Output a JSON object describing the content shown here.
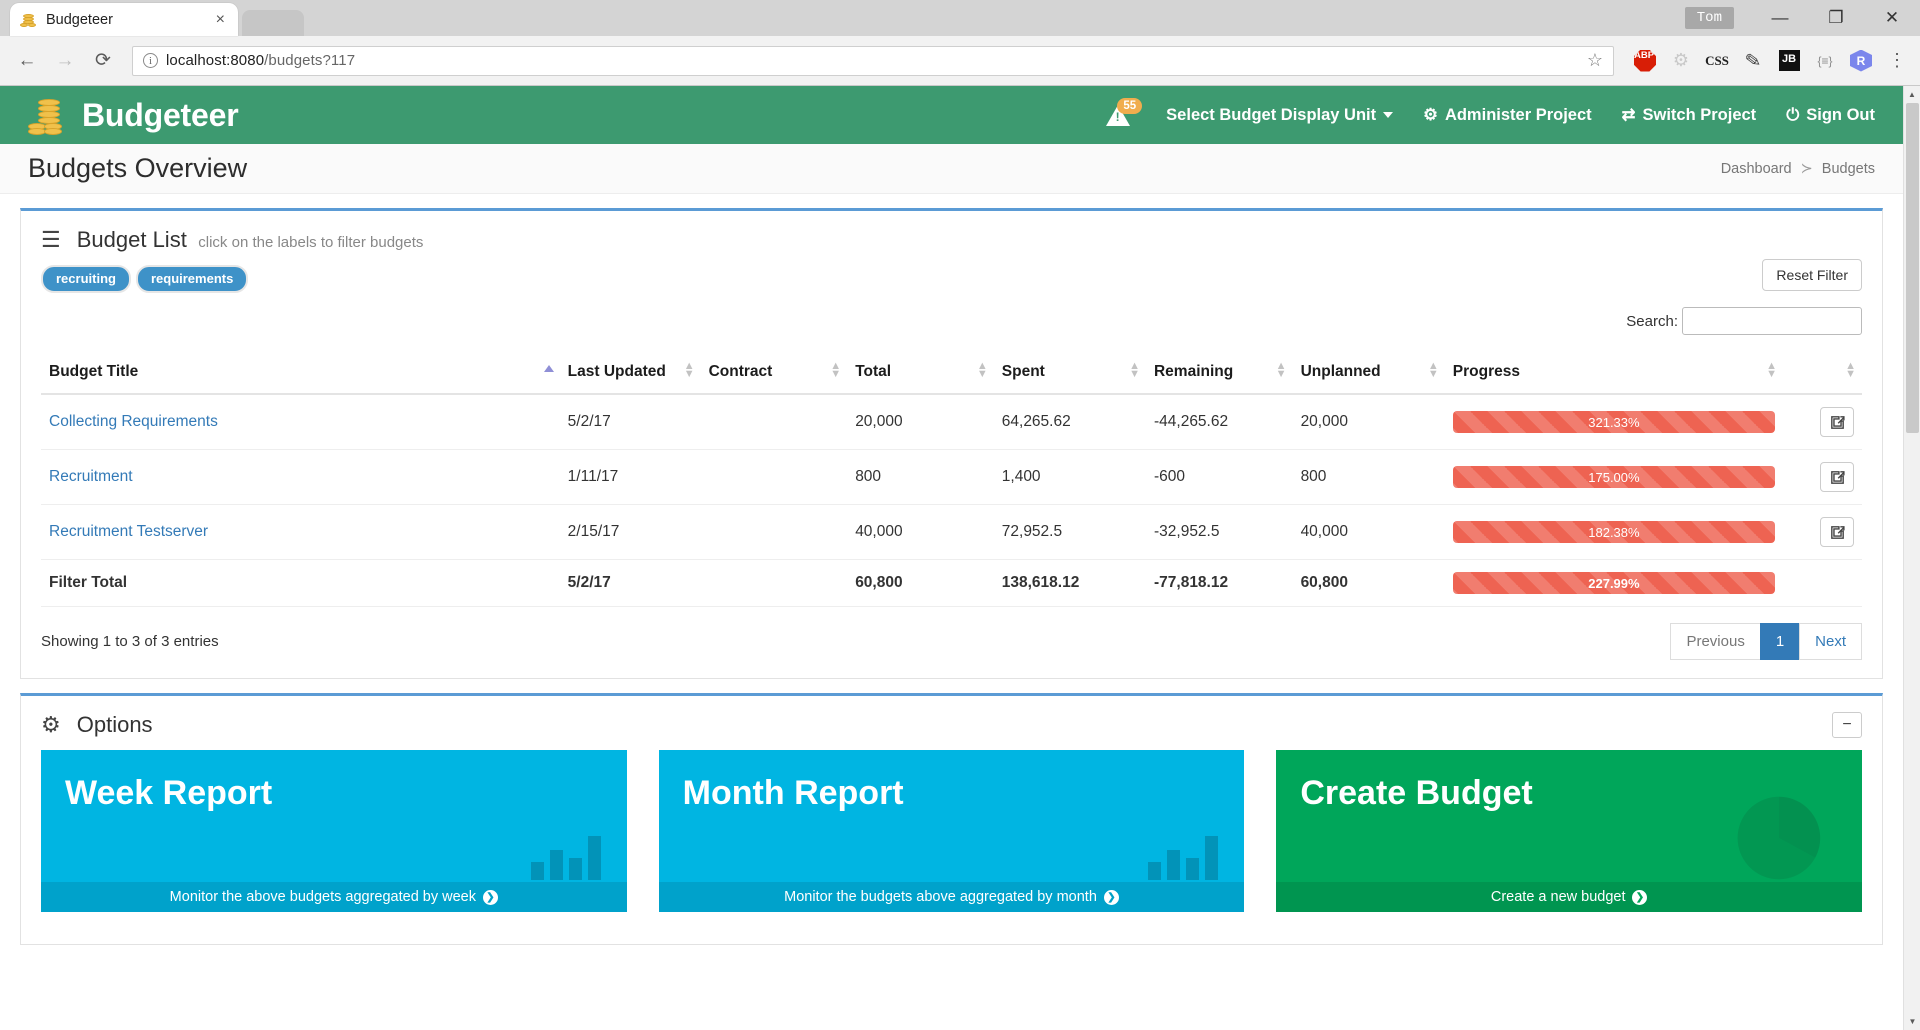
{
  "browser": {
    "tab_title": "Budgeteer",
    "tab_close": "×",
    "url_host": "localhost:8080",
    "url_path": "/budgets?117",
    "info_icon": "ⓘ",
    "back_icon": "←",
    "forward_icon": "→",
    "reload_icon": "⟳",
    "star_icon": "☆",
    "profile_name": "Tom",
    "minimize": "—",
    "maximize": "❐",
    "close": "✕",
    "extensions": [
      {
        "name": "abp-extension-icon",
        "label": "ABP"
      },
      {
        "name": "gear-extension-icon",
        "label": "⚙"
      },
      {
        "name": "css-extension-icon",
        "label": "CSS"
      },
      {
        "name": "pencil-extension-icon",
        "label": "✎"
      },
      {
        "name": "jetbrains-extension-icon",
        "label": "JB"
      },
      {
        "name": "braces-extension-icon",
        "label": "{≡}"
      },
      {
        "name": "r-extension-icon",
        "label": "R"
      }
    ],
    "menu_icon": "⋮"
  },
  "app": {
    "brand": "Budgeteer",
    "nav": {
      "warning_badge": "55",
      "display_unit": "Select Budget Display Unit",
      "administer": "Administer Project",
      "switch_project": "Switch Project",
      "sign_out": "Sign Out",
      "gear_icon": "⚙",
      "switch_icon": "⇄",
      "power_icon": "⏻"
    },
    "page_title": "Budgets Overview",
    "breadcrumb": [
      "Dashboard",
      "Budgets"
    ],
    "breadcrumb_sep": "≻"
  },
  "budget_list": {
    "icon": "☰",
    "title": "Budget List",
    "subtitle": "click on the labels to filter budgets",
    "tags": [
      "recruiting",
      "requirements"
    ],
    "reset_filter": "Reset Filter",
    "search_label": "Search:",
    "search_value": "",
    "search_placeholder": "",
    "columns": [
      "Budget Title",
      "Last Updated",
      "Contract",
      "Total",
      "Spent",
      "Remaining",
      "Unplanned",
      "Progress"
    ],
    "rows": [
      {
        "title": "Collecting Requirements",
        "last_updated": "5/2/17",
        "contract": "",
        "total": "20,000",
        "spent": "64,265.62",
        "remaining": "-44,265.62",
        "unplanned": "20,000",
        "progress_label": "321.33%",
        "progress_value": 100
      },
      {
        "title": "Recruitment",
        "last_updated": "1/11/17",
        "contract": "",
        "total": "800",
        "spent": "1,400",
        "remaining": "-600",
        "unplanned": "800",
        "progress_label": "175.00%",
        "progress_value": 100
      },
      {
        "title": "Recruitment Testserver",
        "last_updated": "2/15/17",
        "contract": "",
        "total": "40,000",
        "spent": "72,952.5",
        "remaining": "-32,952.5",
        "unplanned": "40,000",
        "progress_label": "182.38%",
        "progress_value": 100
      }
    ],
    "total_row": {
      "title": "Filter Total",
      "last_updated": "5/2/17",
      "contract": "",
      "total": "60,800",
      "spent": "138,618.12",
      "remaining": "-77,818.12",
      "unplanned": "60,800",
      "progress_label": "227.99%",
      "progress_value": 100
    },
    "entries_info": "Showing 1 to 3 of 3 entries",
    "pager": {
      "previous": "Previous",
      "pages": [
        "1"
      ],
      "next": "Next"
    }
  },
  "options": {
    "icon": "⚙",
    "title": "Options",
    "collapse_icon": "−",
    "cards": [
      {
        "title": "Week Report",
        "footer": "Monitor the above budgets aggregated by week",
        "arrow": "❯",
        "style": "blue"
      },
      {
        "title": "Month Report",
        "footer": "Monitor the budgets above aggregated by month",
        "arrow": "❯",
        "style": "blue"
      },
      {
        "title": "Create Budget",
        "footer": "Create a new budget",
        "arrow": "❯",
        "style": "green"
      }
    ]
  }
}
